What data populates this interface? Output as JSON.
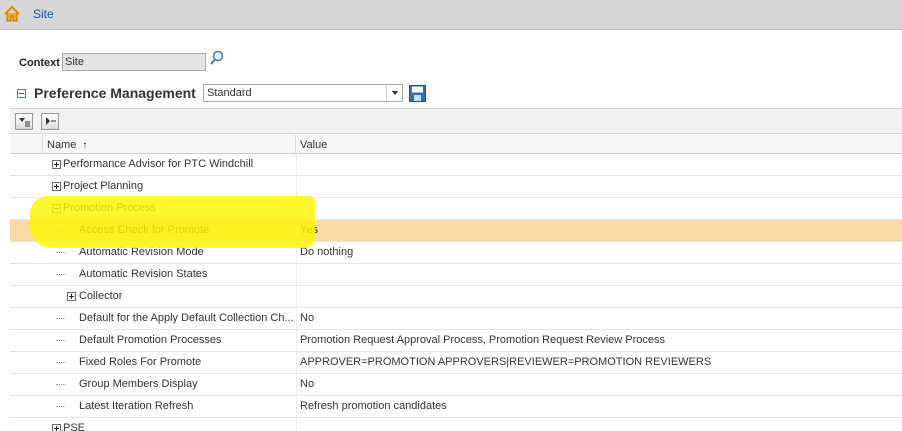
{
  "header": {
    "home_icon": "home-icon",
    "site_link": "Site"
  },
  "context": {
    "label": "Context",
    "value": "Site",
    "search_icon": "search-icon"
  },
  "preference_management": {
    "title": "Preference Management",
    "view_selected": "Standard",
    "save_icon": "save-icon"
  },
  "toolbar": {
    "buttons": [
      "expand-all-icon",
      "collapse-all-icon"
    ]
  },
  "table": {
    "columns": {
      "name": "Name",
      "value": "Value",
      "sort_indicator": "↑"
    },
    "rows": [
      {
        "name": "Performance Advisor for PTC Windchill",
        "value": ""
      },
      {
        "name": "Project Planning",
        "value": ""
      },
      {
        "name": "Promotion Process",
        "value": ""
      },
      {
        "name": "Access Check for Promote",
        "value": "Yes"
      },
      {
        "name": "Automatic Revision Mode",
        "value": "Do nothing"
      },
      {
        "name": "Automatic Revision States",
        "value": ""
      },
      {
        "name": "Collector",
        "value": ""
      },
      {
        "name": "Default for the Apply Default Collection Ch...",
        "value": "No"
      },
      {
        "name": "Default Promotion Processes",
        "value": "Promotion Request Approval Process, Promotion Request Review Process"
      },
      {
        "name": "Fixed Roles For Promote",
        "value": "APPROVER=PROMOTION APPROVERS|REVIEWER=PROMOTION REVIEWERS"
      },
      {
        "name": "Group Members Display",
        "value": "No"
      },
      {
        "name": "Latest Iteration Refresh",
        "value": "Refresh promotion candidates"
      },
      {
        "name": "PSE",
        "value": ""
      }
    ]
  },
  "colors": {
    "topbar": "#d6d6d6",
    "link": "#1a56a8",
    "selected_row": "#f9d9a6",
    "annotation_highlight": "#fff500"
  }
}
